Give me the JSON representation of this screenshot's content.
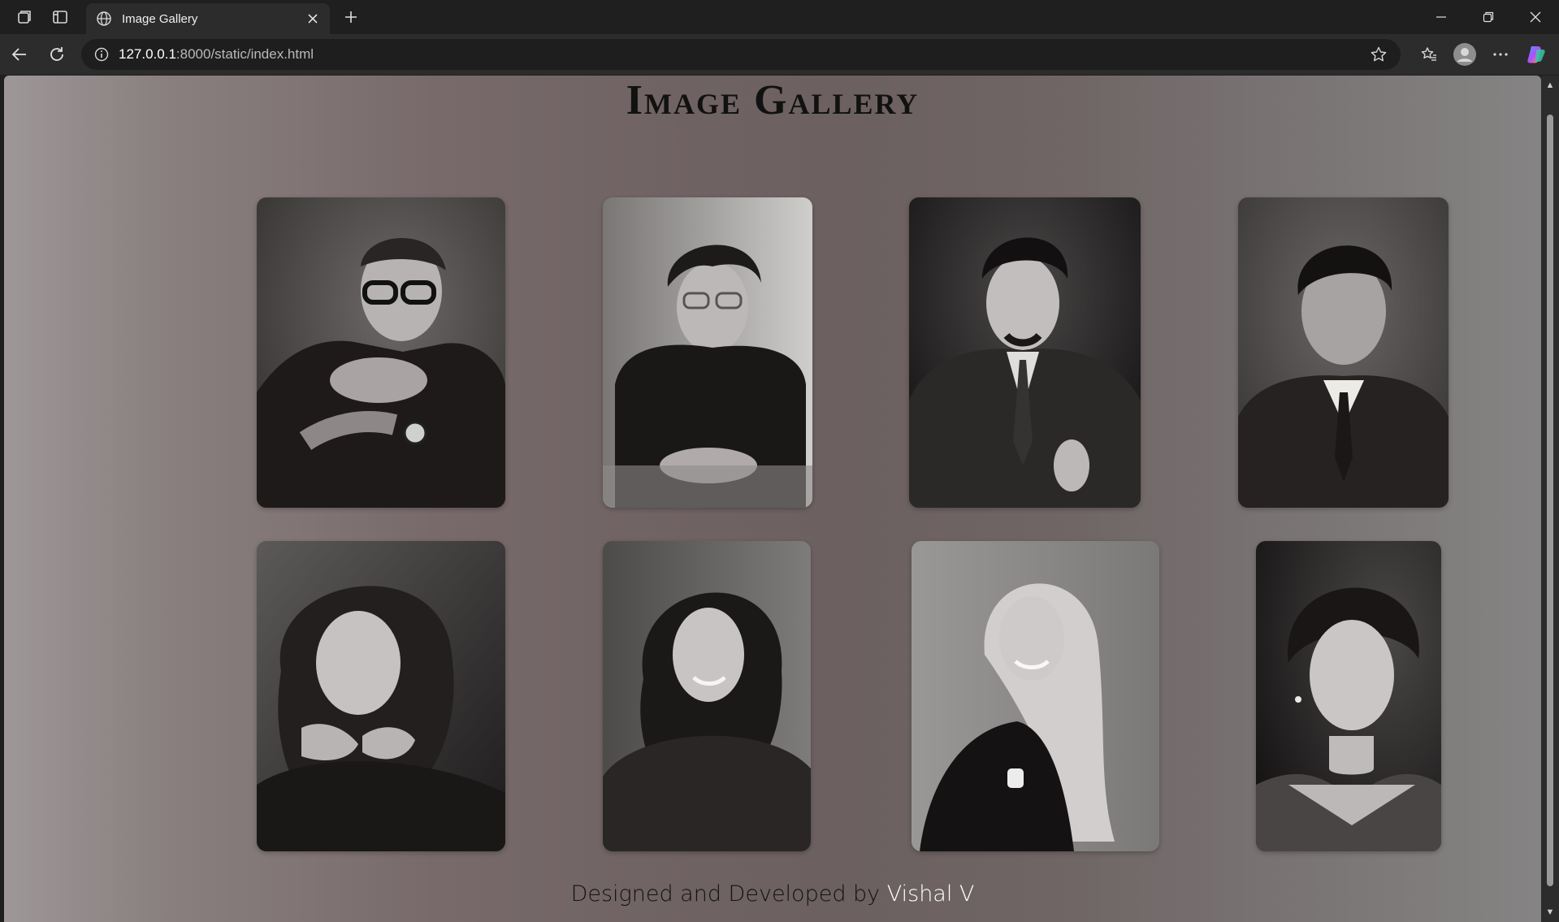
{
  "browser": {
    "tab_title": "Image Gallery",
    "url_host": "127.0.0.1",
    "url_rest": ":8000/static/index.html"
  },
  "page": {
    "title": "Image Gallery",
    "footer_prefix": "Designed and Developed by ",
    "footer_author": "Vishal V"
  },
  "gallery": {
    "rows": [
      [
        {
          "alt": "Man with glasses and wristwatch, hands clasped",
          "tone": "#4a4646"
        },
        {
          "alt": "Young man with curly hair leaning on hands",
          "tone": "#555252"
        },
        {
          "alt": "Man in suit and tie with goatee",
          "tone": "#2c2c2c"
        },
        {
          "alt": "Man with short cropped hair in tie",
          "tone": "#3a3838"
        }
      ],
      [
        {
          "alt": "Woman with wavy hair resting chin on hands",
          "tone": "#3d3b3b"
        },
        {
          "alt": "Smiling woman with long dark hair in sweater",
          "tone": "#353333"
        },
        {
          "alt": "Smiling woman with long blonde hair",
          "tone": "#8a8888"
        },
        {
          "alt": "Woman with hair pulled back, earrings",
          "tone": "#2a2828"
        }
      ]
    ]
  }
}
